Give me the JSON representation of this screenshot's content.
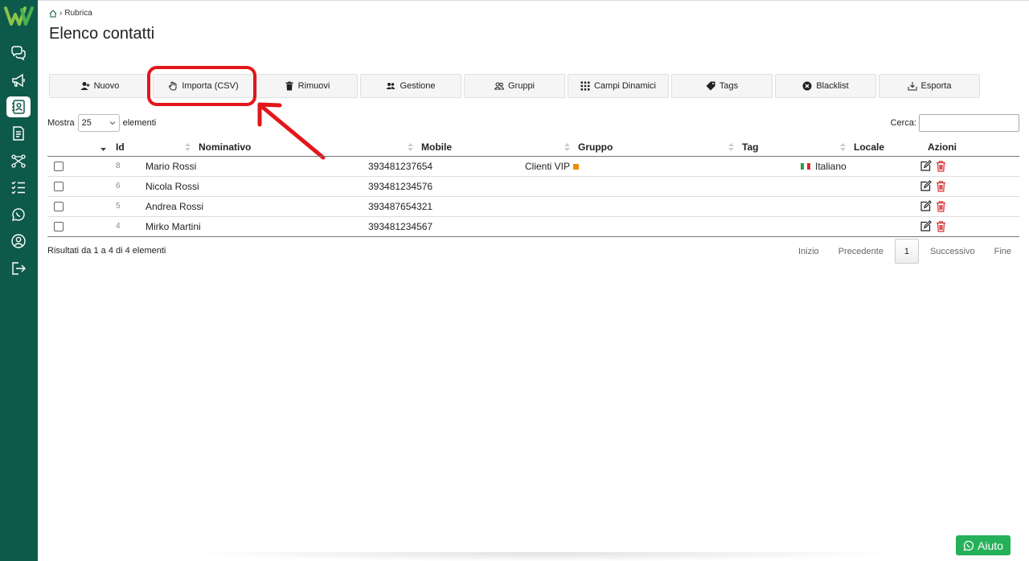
{
  "colors": {
    "sidebar": "#0e5a4a",
    "accent_red": "#e4161b",
    "help_green": "#25b05a",
    "group_badge": "#f08c00"
  },
  "sidebar": {
    "items": [
      {
        "icon": "chat-icon"
      },
      {
        "icon": "megaphone-icon"
      },
      {
        "icon": "contacts-icon",
        "active": true
      },
      {
        "icon": "document-icon"
      },
      {
        "icon": "flow-icon"
      },
      {
        "icon": "checklist-icon"
      },
      {
        "icon": "whatsapp-icon"
      },
      {
        "icon": "user-circle-icon"
      },
      {
        "icon": "logout-icon"
      }
    ]
  },
  "breadcrumb": {
    "home_icon": "home-icon",
    "current": "Rubrica"
  },
  "page": {
    "title": "Elenco contatti"
  },
  "toolbar": {
    "buttons": [
      {
        "label": "Nuovo",
        "icon": "user-plus-icon"
      },
      {
        "label": "Importa (CSV)",
        "icon": "hand-icon"
      },
      {
        "label": "Rimuovi",
        "icon": "trash-icon"
      },
      {
        "label": "Gestione",
        "icon": "users-icon"
      },
      {
        "label": "Gruppi",
        "icon": "group-icon"
      },
      {
        "label": "Campi Dinamici",
        "icon": "grid-icon"
      },
      {
        "label": "Tags",
        "icon": "tag-icon"
      },
      {
        "label": "Blacklist",
        "icon": "x-circle-icon"
      },
      {
        "label": "Esporta",
        "icon": "download-icon"
      }
    ]
  },
  "length_menu": {
    "before": "Mostra",
    "value": "25",
    "after": "elementi"
  },
  "search": {
    "label": "Cerca:",
    "value": ""
  },
  "table": {
    "columns": [
      "Id",
      "Nominativo",
      "Mobile",
      "Gruppo",
      "Tag",
      "Locale",
      "Azioni"
    ],
    "rows": [
      {
        "id": "8",
        "name": "Mario Rossi",
        "mobile": "393481237654",
        "group": "Clienti VIP",
        "tag": "",
        "locale": "Italiano"
      },
      {
        "id": "6",
        "name": "Nicola Rossi",
        "mobile": "393481234576",
        "group": "",
        "tag": "",
        "locale": ""
      },
      {
        "id": "5",
        "name": "Andrea Rossi",
        "mobile": "393487654321",
        "group": "",
        "tag": "",
        "locale": ""
      },
      {
        "id": "4",
        "name": "Mirko Martini",
        "mobile": "393481234567",
        "group": "",
        "tag": "",
        "locale": ""
      }
    ]
  },
  "info": "Risultati da 1 a 4 di 4 elementi",
  "pagination": {
    "first": "Inizio",
    "prev": "Precedente",
    "current": "1",
    "next": "Successivo",
    "last": "Fine"
  },
  "help": {
    "label": "Aiuto"
  }
}
